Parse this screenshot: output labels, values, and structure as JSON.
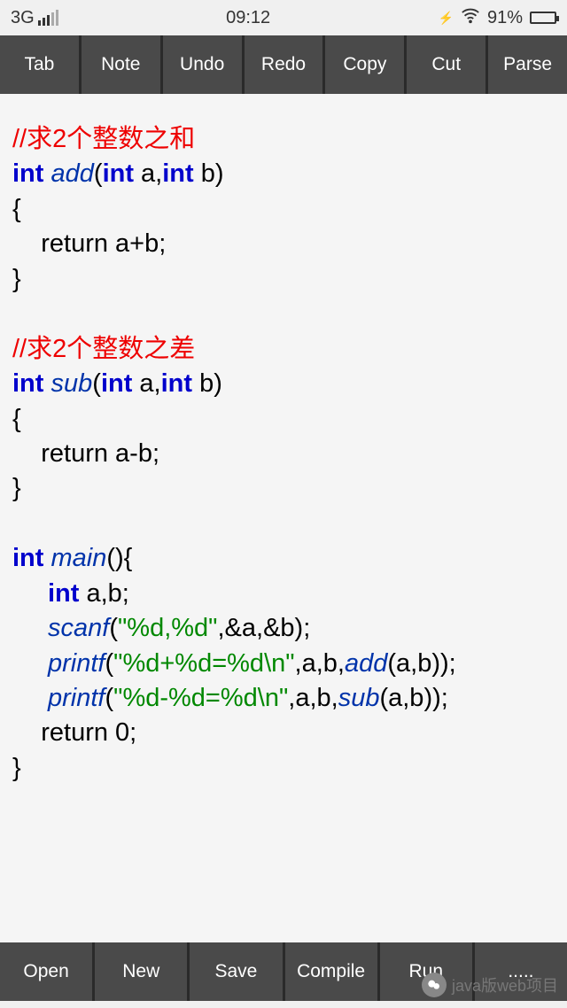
{
  "status": {
    "network": "3G",
    "time": "09:12",
    "battery_pct": "91%"
  },
  "toolbar": {
    "tab": "Tab",
    "note": "Note",
    "undo": "Undo",
    "redo": "Redo",
    "copy": "Copy",
    "cut": "Cut",
    "parse": "Parse"
  },
  "code": {
    "c1": "//求2个整数之和",
    "l2_int1": "int ",
    "l2_fn": "add",
    "l2_open": "(",
    "l2_int2": "int",
    "l2_a": " a,",
    "l2_int3": "int",
    "l2_b": " b)",
    "l3": "{",
    "l4_ret": "    return a+b;",
    "l5": "}",
    "c2": "//求2个整数之差",
    "l7_int1": "int ",
    "l7_fn": "sub",
    "l7_open": "(",
    "l7_int2": "int",
    "l7_a": " a,",
    "l7_int3": "int",
    "l7_b": " b)",
    "l8": "{",
    "l9_ret": "    return a-b;",
    "l10": "}",
    "m1_int": "int ",
    "m1_fn": "main",
    "m1_rest": "(){",
    "m2_int": "int",
    "m2_rest": " a,b;",
    "m3_fn": "scanf",
    "m3_open": "(",
    "m3_str": "\"%d,%d\"",
    "m3_rest": ",&a,&b);",
    "m4_fn": "printf",
    "m4_open": "(",
    "m4_str": "\"%d+%d=%d\\n\"",
    "m4_mid": ",a,b,",
    "m4_call": "add",
    "m4_end": "(a,b));",
    "m5_fn": "printf",
    "m5_open": "(",
    "m5_str": "\"%d-%d=%d\\n\"",
    "m5_mid": ",a,b,",
    "m5_call": "sub",
    "m5_end": "(a,b));",
    "m6_ret": "    return 0;",
    "m7": "}"
  },
  "bottom": {
    "open": "Open",
    "new": "New",
    "save": "Save",
    "compile": "Compile",
    "run": "Run",
    "more": "....."
  },
  "watermark": "java版web项目"
}
